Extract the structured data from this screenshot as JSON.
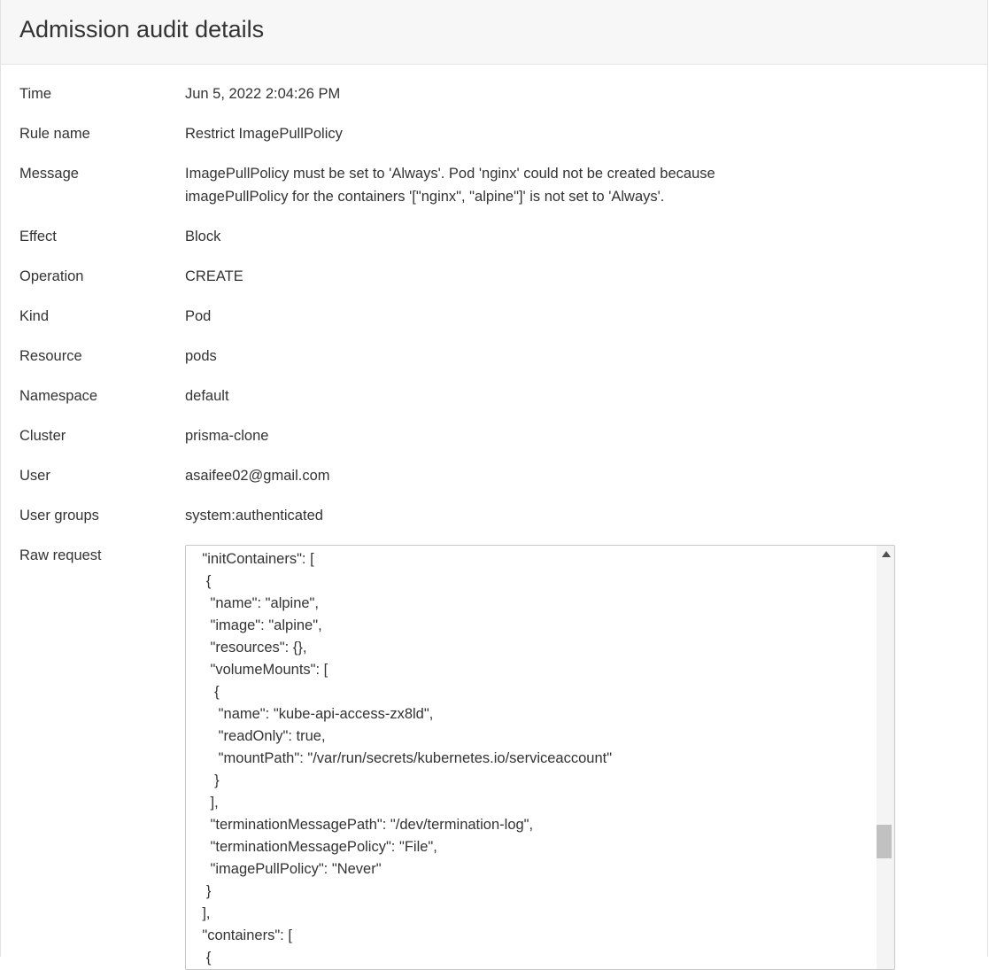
{
  "header": {
    "title": "Admission audit details"
  },
  "details": [
    {
      "label": "Time",
      "value": "Jun 5, 2022 2:04:26 PM"
    },
    {
      "label": "Rule name",
      "value": "Restrict ImagePullPolicy"
    },
    {
      "label": "Message",
      "value": "ImagePullPolicy must be set to 'Always'. Pod 'nginx' could not be created because\nimagePullPolicy for the containers '[\"nginx\", \"alpine\"]' is not set to 'Always'."
    },
    {
      "label": "Effect",
      "value": "Block"
    },
    {
      "label": "Operation",
      "value": "CREATE"
    },
    {
      "label": "Kind",
      "value": "Pod"
    },
    {
      "label": "Resource",
      "value": "pods"
    },
    {
      "label": "Namespace",
      "value": "default"
    },
    {
      "label": "Cluster",
      "value": "prisma-clone"
    },
    {
      "label": "User",
      "value": "asaifee02@gmail.com"
    },
    {
      "label": "User groups",
      "value": "system:authenticated"
    }
  ],
  "raw_request": {
    "label": "Raw request",
    "lines": [
      "    \"initContainers\": [",
      "     {",
      "      \"name\": \"alpine\",",
      "      \"image\": \"alpine\",",
      "      \"resources\": {},",
      "      \"volumeMounts\": [",
      "       {",
      "        \"name\": \"kube-api-access-zx8ld\",",
      "        \"readOnly\": true,",
      "        \"mountPath\": \"/var/run/secrets/kubernetes.io/serviceaccount\"",
      "       }",
      "      ],",
      "      \"terminationMessagePath\": \"/dev/termination-log\",",
      "      \"terminationMessagePolicy\": \"File\",",
      "      \"imagePullPolicy\": \"Never\"",
      "     }",
      "    ],",
      "    \"containers\": [",
      "     {"
    ]
  }
}
